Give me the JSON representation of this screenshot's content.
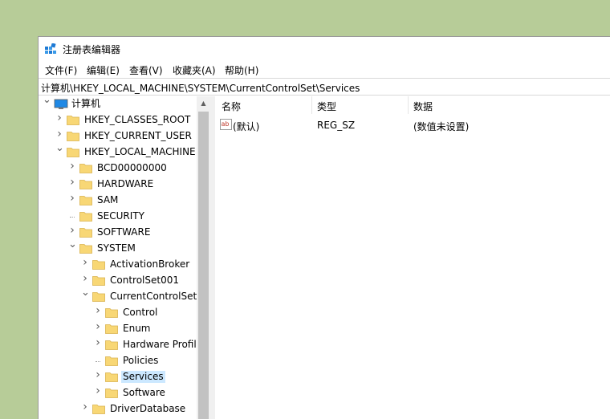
{
  "window": {
    "title": "注册表编辑器",
    "icon": "regedit-icon"
  },
  "menu": [
    "文件(F)",
    "编辑(E)",
    "查看(V)",
    "收藏夹(A)",
    "帮助(H)"
  ],
  "address": "计算机\\HKEY_LOCAL_MACHINE\\SYSTEM\\CurrentControlSet\\Services",
  "tree": [
    {
      "label": "计算机",
      "depth": 0,
      "expander": "expanded",
      "icon": "computer-icon"
    },
    {
      "label": "HKEY_CLASSES_ROOT",
      "depth": 1,
      "expander": "collapsed",
      "icon": "folder-icon"
    },
    {
      "label": "HKEY_CURRENT_USER",
      "depth": 1,
      "expander": "collapsed",
      "icon": "folder-icon"
    },
    {
      "label": "HKEY_LOCAL_MACHINE",
      "depth": 1,
      "expander": "expanded",
      "icon": "folder-icon"
    },
    {
      "label": "BCD00000000",
      "depth": 2,
      "expander": "collapsed",
      "icon": "folder-icon"
    },
    {
      "label": "HARDWARE",
      "depth": 2,
      "expander": "collapsed",
      "icon": "folder-icon"
    },
    {
      "label": "SAM",
      "depth": 2,
      "expander": "collapsed",
      "icon": "folder-icon"
    },
    {
      "label": "SECURITY",
      "depth": 2,
      "expander": "none",
      "icon": "folder-icon"
    },
    {
      "label": "SOFTWARE",
      "depth": 2,
      "expander": "collapsed",
      "icon": "folder-icon"
    },
    {
      "label": "SYSTEM",
      "depth": 2,
      "expander": "expanded",
      "icon": "folder-icon"
    },
    {
      "label": "ActivationBroker",
      "depth": 3,
      "expander": "collapsed",
      "icon": "folder-icon"
    },
    {
      "label": "ControlSet001",
      "depth": 3,
      "expander": "collapsed",
      "icon": "folder-icon"
    },
    {
      "label": "CurrentControlSet",
      "depth": 3,
      "expander": "expanded",
      "icon": "folder-icon"
    },
    {
      "label": "Control",
      "depth": 4,
      "expander": "collapsed",
      "icon": "folder-icon"
    },
    {
      "label": "Enum",
      "depth": 4,
      "expander": "collapsed",
      "icon": "folder-icon"
    },
    {
      "label": "Hardware Profil",
      "depth": 4,
      "expander": "collapsed",
      "icon": "folder-icon"
    },
    {
      "label": "Policies",
      "depth": 4,
      "expander": "none",
      "icon": "folder-icon"
    },
    {
      "label": "Services",
      "depth": 4,
      "expander": "collapsed",
      "icon": "folder-icon",
      "selected": true
    },
    {
      "label": "Software",
      "depth": 4,
      "expander": "collapsed",
      "icon": "folder-icon"
    },
    {
      "label": "DriverDatabase",
      "depth": 3,
      "expander": "collapsed",
      "icon": "folder-icon"
    }
  ],
  "list": {
    "columns": [
      "名称",
      "类型",
      "数据"
    ],
    "rows": [
      {
        "name": "(默认)",
        "type": "REG_SZ",
        "data": "(数值未设置)",
        "icon": "string-value-icon"
      }
    ]
  },
  "colors": {
    "desktop": "#b7cc98",
    "selection": "#cce8ff",
    "folder": "#f8d775",
    "monitor": "#1e88e5"
  }
}
